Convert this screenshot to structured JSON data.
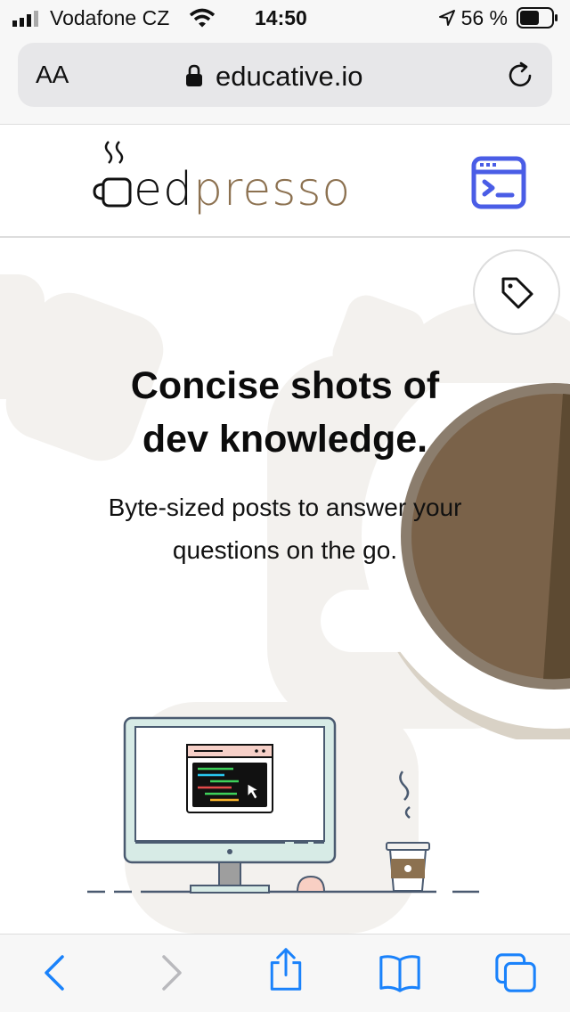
{
  "status_bar": {
    "carrier": "Vodafone CZ",
    "time": "14:50",
    "battery_percent": "56 %"
  },
  "browser": {
    "text_size_label": "AA",
    "domain": "educative.io"
  },
  "site": {
    "logo_part1": "ed",
    "logo_part2": "presso"
  },
  "hero": {
    "heading_line1": "Concise shots of",
    "heading_line2": "dev knowledge.",
    "sub_line1": "Byte-sized posts to answer your",
    "sub_line2": "questions on the go."
  },
  "colors": {
    "brand_brown": "#8c7150",
    "accent_blue": "#4a5de6",
    "ios_blue": "#1a82fb",
    "hero_shapes": "#f3f1ee"
  },
  "icons": {
    "reload": "reload-icon",
    "lock": "lock-icon",
    "tag": "tag-icon",
    "console": "console-icon",
    "back": "back-icon",
    "forward": "forward-icon",
    "share": "share-icon",
    "bookmarks": "bookmarks-icon",
    "tabs": "tabs-icon"
  }
}
